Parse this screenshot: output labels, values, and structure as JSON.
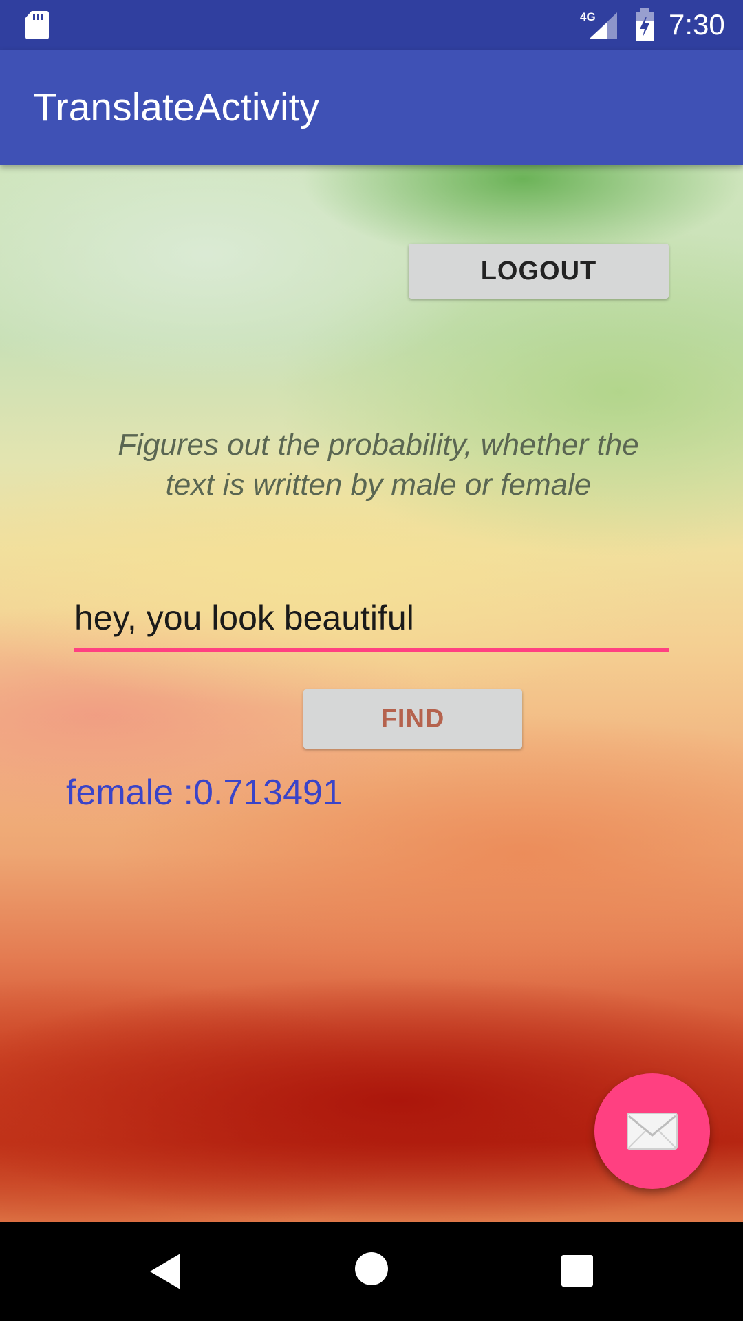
{
  "status_bar": {
    "time": "7:30",
    "network_label": "4G",
    "icons": [
      "sd-card-icon",
      "signal-icon",
      "battery-charging-icon"
    ]
  },
  "app_bar": {
    "title": "TranslateActivity"
  },
  "main": {
    "logout_label": "LOGOUT",
    "description": "Figures out the probability, whether the text is written by male or female",
    "input_value": "hey, you look beautiful",
    "find_label": "FIND",
    "result_text": "female :0.713491",
    "fab_icon": "mail-icon"
  },
  "nav_bar": {
    "icons": [
      "back-icon",
      "home-icon",
      "recents-icon"
    ]
  },
  "colors": {
    "status_bar": "#303F9F",
    "app_bar": "#3F51B5",
    "accent": "#FF4081",
    "result_text": "#3A44C8",
    "find_text": "#B5624D"
  }
}
